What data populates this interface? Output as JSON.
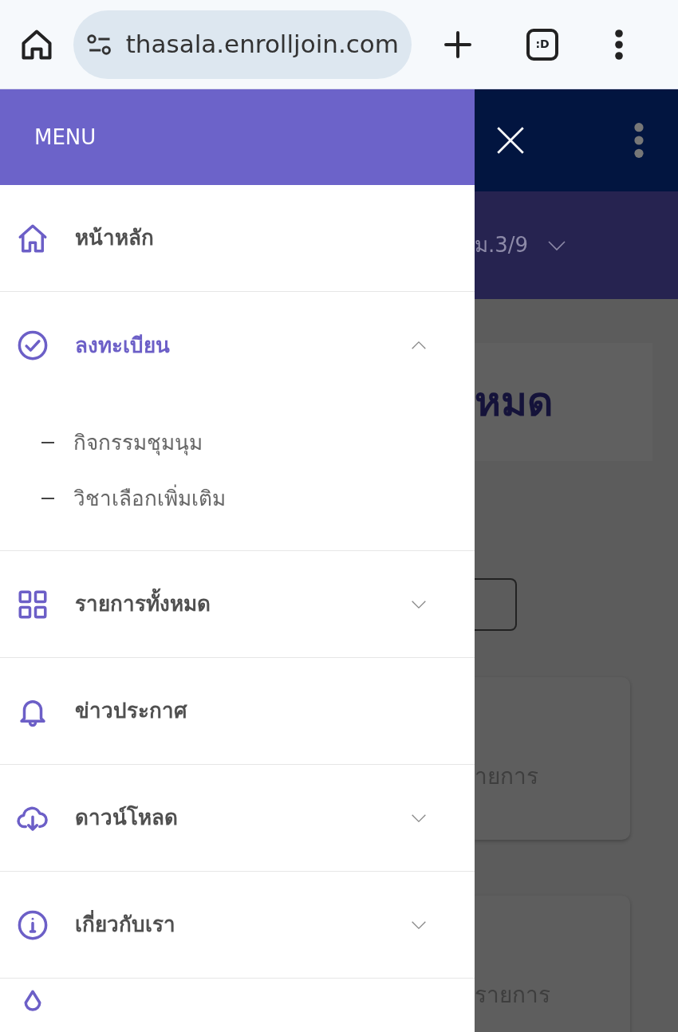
{
  "browser": {
    "url": "thasala.enrolljoin.com",
    "tab_count": ":D"
  },
  "menu": {
    "title": "MENU",
    "items": [
      {
        "label": "หน้าหลัก",
        "selected": false
      },
      {
        "label": "ลงทะเบียน",
        "selected": true,
        "expanded": true,
        "children": [
          {
            "label": "กิจกรรมชุมนุม"
          },
          {
            "label": "วิชาเลือกเพิ่มเติม"
          }
        ]
      },
      {
        "label": "รายการทั้งหมด",
        "selected": false,
        "expanded": false
      },
      {
        "label": "ข่าวประกาศ",
        "selected": false
      },
      {
        "label": "ดาวน์โหลด",
        "selected": false,
        "expanded": false
      },
      {
        "label": "เกี่ยวกับเรา",
        "selected": false,
        "expanded": false
      },
      {
        "kind": "partial"
      }
    ]
  },
  "page": {
    "class_select": "ม.3/9",
    "heading": "หมด",
    "cards": [
      {
        "text": "ายการ"
      },
      {
        "text": "รายการ"
      }
    ]
  }
}
